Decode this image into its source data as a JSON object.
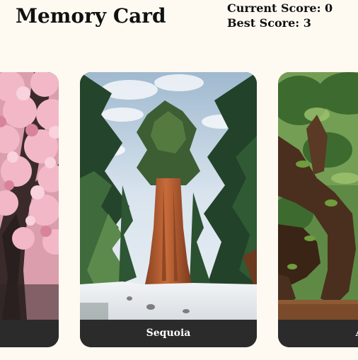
{
  "header": {
    "title": "Memory Card",
    "current_score_label": "Current Score: 0",
    "best_score_label": "Best Score: 3"
  },
  "cards": [
    {
      "image_icon": "cherry-blossom-tree-photo",
      "caption": ""
    },
    {
      "image_icon": "sequoia-tree-photo",
      "caption": "Sequoia"
    },
    {
      "image_icon": "angel-oak-tree-photo",
      "caption": "Ang"
    }
  ],
  "colors": {
    "background": "#fefaf2",
    "caption_bar": "#2b2b2b",
    "caption_text": "#ffffff"
  }
}
